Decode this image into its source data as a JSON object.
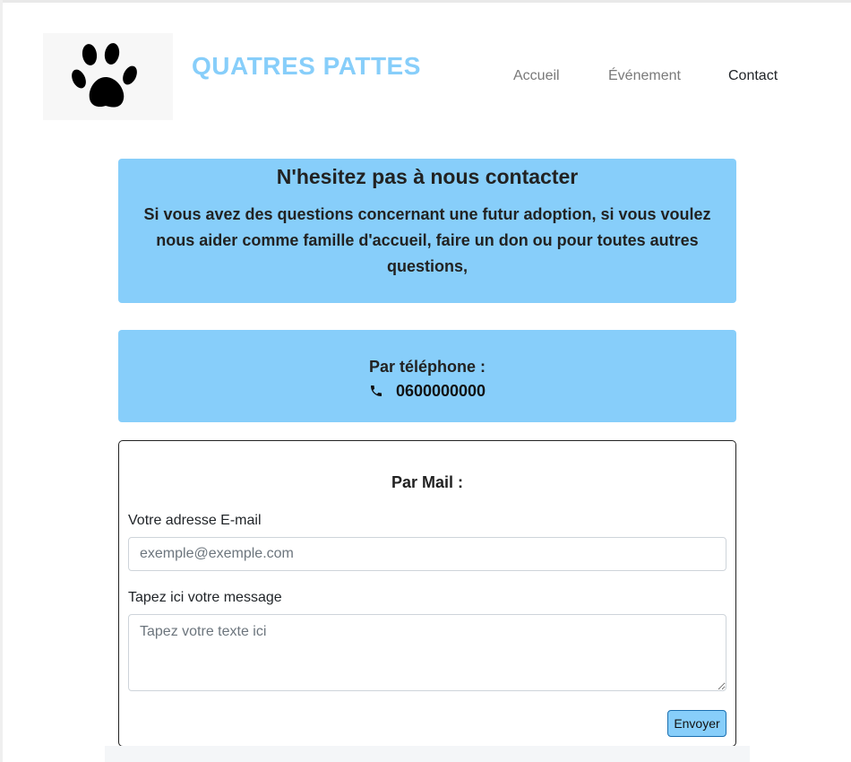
{
  "brand": {
    "name": "QUATRES PATTES",
    "logo": "paw-print-icon",
    "color": "#87cefa"
  },
  "nav": {
    "items": [
      {
        "label": "Accueil",
        "active": false
      },
      {
        "label": "Événement",
        "active": false
      },
      {
        "label": "Contact",
        "active": true
      }
    ]
  },
  "intro": {
    "heading": "N'hesitez pas à nous contacter",
    "text": "Si vous avez des questions concernant une futur adoption, si vous voulez nous aider comme famille d'accueil, faire un don ou pour toutes autres questions,"
  },
  "phone": {
    "title": "Par téléphone :",
    "icon": "phone-icon",
    "number": "0600000000"
  },
  "mail": {
    "title": "Par Mail :",
    "email_label": "Votre adresse E-mail",
    "email_value": "",
    "email_placeholder": "exemple@exemple.com",
    "message_label": "Tapez ici votre message",
    "message_value": "",
    "message_placeholder": "Tapez votre texte ici",
    "submit_label": "Envoyer"
  },
  "colors": {
    "accent": "#87cefa",
    "text": "#212529",
    "muted": "#7a7a7a"
  }
}
